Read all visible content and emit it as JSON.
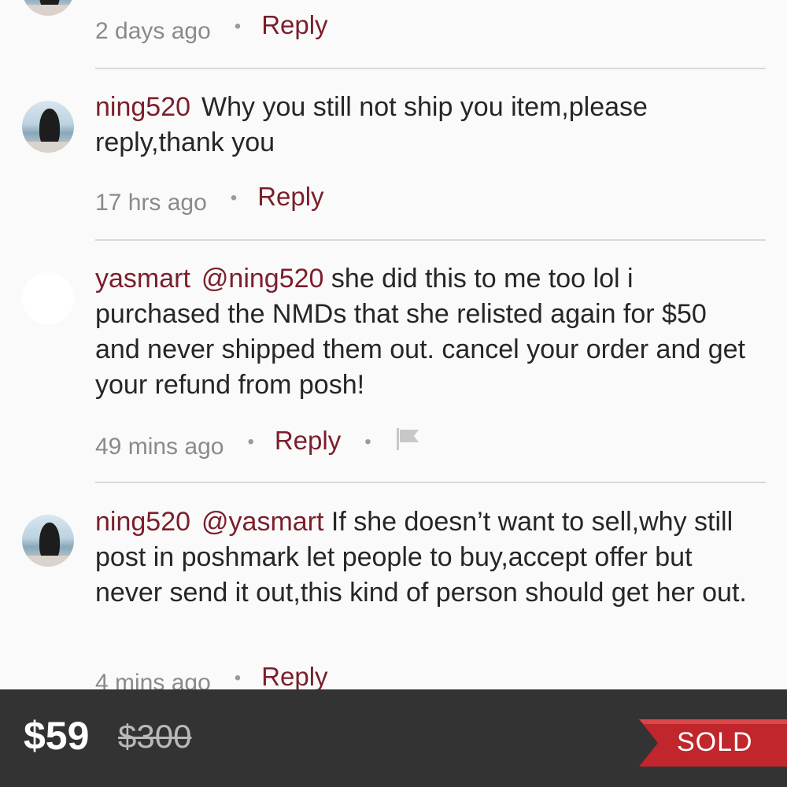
{
  "comments": [
    {
      "id": "c0",
      "username": "",
      "mention": "",
      "text": "",
      "time": "2 days ago",
      "reply_label": "Reply",
      "has_flag": false,
      "avatar": "photo"
    },
    {
      "id": "c1",
      "username": "ning520",
      "mention": "",
      "text": "Why you still not ship you item,please reply,thank you",
      "time": "17 hrs ago",
      "reply_label": "Reply",
      "has_flag": false,
      "avatar": "photo"
    },
    {
      "id": "c2",
      "username": "yasmart",
      "mention": "@ning520",
      "text": "she did this to me too lol i purchased the NMDs that she relisted again for $50 and never shipped them out. cancel your order and get your refund from posh!",
      "time": "49 mins ago",
      "reply_label": "Reply",
      "has_flag": true,
      "avatar": "blank"
    },
    {
      "id": "c3",
      "username": "ning520",
      "mention": "@yasmart",
      "text": "If she doesn’t want to sell,why still post in poshmark let people to buy,accept offer but never send it out,this kind of person should get her out.",
      "time": "4 mins ago",
      "reply_label": "Reply",
      "has_flag": false,
      "avatar": "photo"
    }
  ],
  "listing": {
    "price": "$59",
    "original_price": "$300",
    "status": "SOLD"
  },
  "colors": {
    "accent": "#7a1f2b",
    "ribbon": "#c0262b",
    "bar": "#333333"
  },
  "icons": {
    "flag": "flag-icon"
  }
}
